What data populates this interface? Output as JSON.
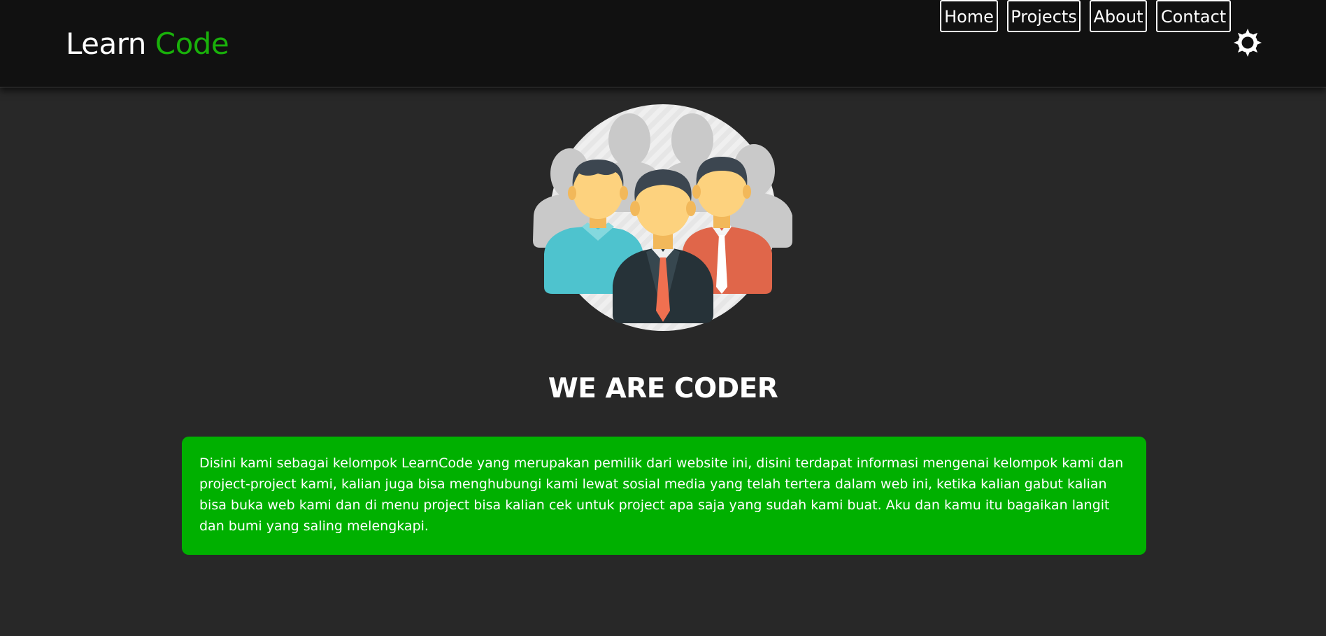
{
  "header": {
    "logo_part1": "Learn",
    "logo_part2": "Code",
    "nav": [
      {
        "label": "Home"
      },
      {
        "label": "Projects"
      },
      {
        "label": "About"
      },
      {
        "label": "Contact"
      }
    ],
    "theme_icon": "sun-icon"
  },
  "hero": {
    "image_icon": "team-group-icon",
    "title": "WE ARE CODER"
  },
  "about": {
    "text": "Disini kami sebagai kelompok LearnCode yang merupakan pemilik dari website ini, disini terdapat informasi mengenai kelompok kami dan project-project kami, kalian juga bisa menghubungi kami lewat sosial media yang telah tertera dalam web ini, ketika kalian gabut kalian bisa buka web kami dan di menu project bisa kalian cek untuk project apa saja yang sudah kami buat. Aku dan kamu itu bagaikan langit dan bumi yang saling melengkapi."
  },
  "colors": {
    "page_background": "#282828",
    "navbar_background": "#111111",
    "accent_green": "#19b00a",
    "card_green": "#00b000",
    "text": "#ffffff"
  }
}
